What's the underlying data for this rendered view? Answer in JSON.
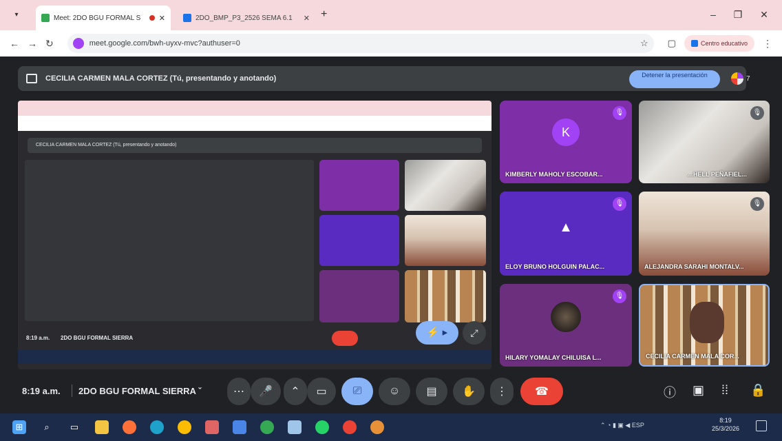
{
  "browser": {
    "tab1_title": "Meet: 2DO BGU FORMAL S",
    "tab2_title": "2DO_BMP_P3_2526 SEMA 6.1",
    "url": "meet.google.com/bwh-uyxv-mvc?authuser=0",
    "profile_label": "Centro educativo"
  },
  "meet": {
    "presenter_text": "CECILIA CARMEN MALA CORTEZ (Tú, presentando y anotando)",
    "stop_button": "Detener la presentación",
    "people_count": "7",
    "time": "8:19 a.m.",
    "meeting_name": "2DO BGU FORMAL SIERRA",
    "meeting_caret": "ˇ",
    "participants": [
      {
        "name": "KIMBERLY MAHOLY ESCOBAR...",
        "initial": "K"
      },
      {
        "name": "…HELL PEÑAFIEL..."
      },
      {
        "name": "ELOY BRUNO HOLGUIN PALAC..."
      },
      {
        "name": "ALEJANDRA SARAHI MONTALV..."
      },
      {
        "name": "HILARY YOMALAY CHILUISA L..."
      },
      {
        "name": "CECILIA CARMEN MALA COR..."
      }
    ]
  },
  "share_preview": {
    "presenter_text": "CECILIA CARMEN MALA CORTEZ (Tú, presentando y anotando)",
    "time": "8:19 a.m.",
    "meeting_name": "2DO BGU FORMAL SIERRA"
  },
  "taskbar": {
    "tray_lang": "ESP",
    "clock_time": "8:19",
    "clock_date": "25/3/2026"
  },
  "colors": {
    "accent_blue": "#8ab4f8",
    "end_call_red": "#ea4335",
    "tile_purple": "#7e2fa8"
  }
}
